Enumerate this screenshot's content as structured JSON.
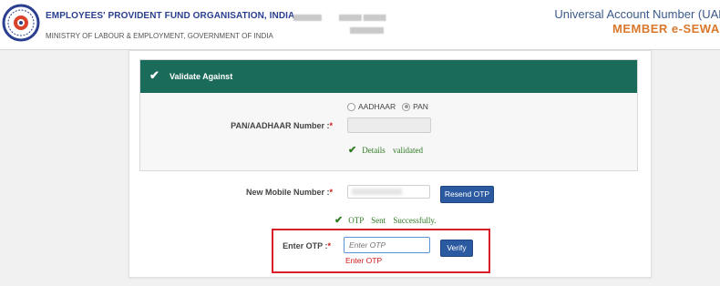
{
  "header": {
    "org_name": "EMPLOYEES' PROVIDENT FUND ORGANISATION, INDIA",
    "ministry": "MINISTRY OF LABOUR & EMPLOYMENT, GOVERNMENT OF INDIA",
    "portal_title": "Universal Account Number (UAN)",
    "portal_subtitle": "MEMBER e-SEWA",
    "logo_icon": "epfo-emblem-icon"
  },
  "validate_panel": {
    "title": "Validate Against",
    "title_icon": "check-icon",
    "radio_options": [
      "AADHAAR",
      "PAN"
    ],
    "selected_option": "PAN",
    "id_label": "PAN/AADHAAR Number :",
    "required_mark": "*",
    "id_value": "",
    "validated_message": "Details validated"
  },
  "mobile": {
    "label": "New Mobile Number :",
    "required_mark": "*",
    "resend_label": "Resend OTP",
    "otp_status": "OTP Sent Successfully."
  },
  "otp": {
    "label": "Enter OTP :",
    "required_mark": "*",
    "placeholder": "Enter OTP",
    "verify_label": "Verify",
    "error": "Enter OTP"
  },
  "colors": {
    "panel_header": "#1b6b5b",
    "button": "#2c5aa0",
    "success": "#2f7a22",
    "error": "#d01818",
    "highlight_box": "#d9202a",
    "brand_orange": "#d9772b"
  }
}
